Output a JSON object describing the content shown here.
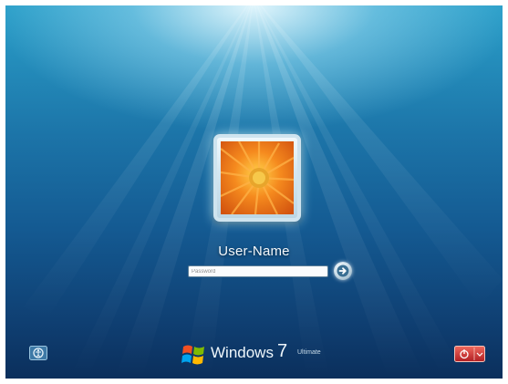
{
  "user": {
    "name": "User-Name"
  },
  "password": {
    "placeholder": "Password",
    "value": ""
  },
  "brand": {
    "name": "Windows",
    "version": "7",
    "edition": "Ultimate"
  },
  "icons": {
    "user_picture": "orange-flower-icon",
    "submit": "arrow-right-icon",
    "accessibility": "ease-of-access-icon",
    "shutdown": "shutdown-icon",
    "logo": "windows-flag-icon"
  },
  "colors": {
    "background_top": "#2a9fc9",
    "background_bottom": "#0b2f5c",
    "flower": "#f27a1a",
    "shutdown": "#c0282b"
  }
}
